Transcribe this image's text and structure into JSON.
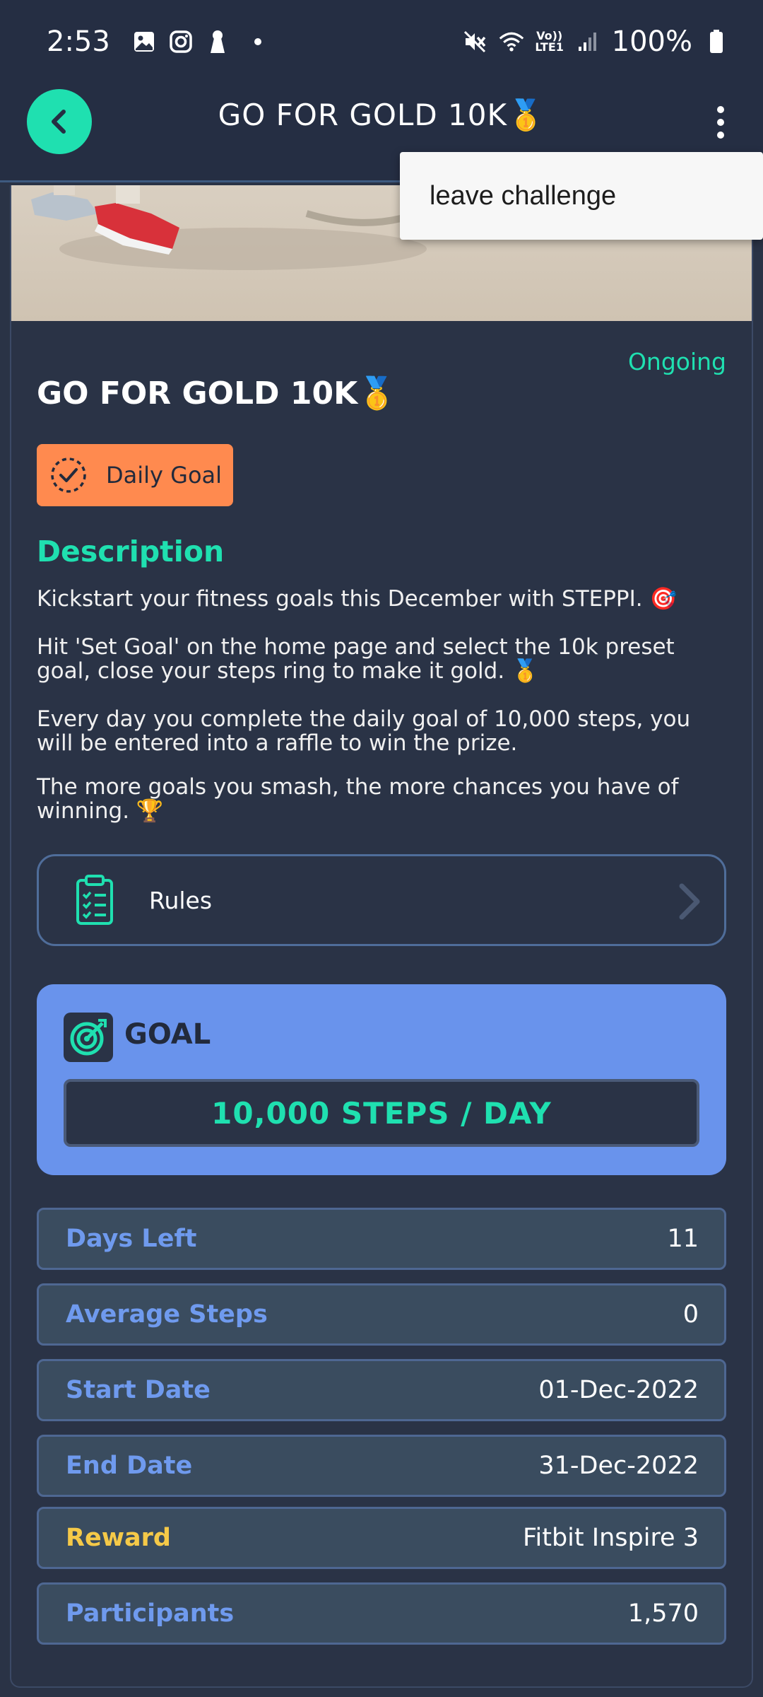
{
  "status_bar": {
    "time": "2:53",
    "lte_top": "Vo))",
    "lte_bottom": "LTE1",
    "battery": "100%"
  },
  "app_bar": {
    "title": "GO FOR GOLD 10K🥇"
  },
  "menu": {
    "items": [
      "leave challenge"
    ]
  },
  "challenge": {
    "status": "Ongoing",
    "title": "GO FOR GOLD 10K🥇",
    "goal_type": "Daily Goal"
  },
  "description": {
    "heading": "Description",
    "paragraphs": [
      "Kickstart your fitness goals this December with STEPPI. 🎯",
      "Hit 'Set Goal' on the home page and select the 10k preset goal, close your steps ring to make it gold. 🥇",
      "Every day you complete the daily goal of 10,000 steps, you will be entered into a raffle to win the prize.",
      "The more goals you smash, the more chances you have of winning. 🏆"
    ]
  },
  "rules": {
    "label": "Rules"
  },
  "goal": {
    "heading": "GOAL",
    "value": "10,000 STEPS / DAY"
  },
  "stats": [
    {
      "label": "Days Left",
      "value": "11"
    },
    {
      "label": "Average Steps",
      "value": "0"
    },
    {
      "label": "Start Date",
      "value": "01-Dec-2022"
    },
    {
      "label": "End Date",
      "value": "31-Dec-2022"
    },
    {
      "label": "Reward",
      "value": "Fitbit Inspire 3"
    },
    {
      "label": "Participants",
      "value": "1,570"
    }
  ],
  "colors": {
    "accent": "#1fe0b0",
    "background": "#2a3346",
    "goal_card": "#6993ec",
    "badge": "#ff8a4f",
    "reward_label": "#f5c948",
    "stat_label": "#6f9aee"
  }
}
